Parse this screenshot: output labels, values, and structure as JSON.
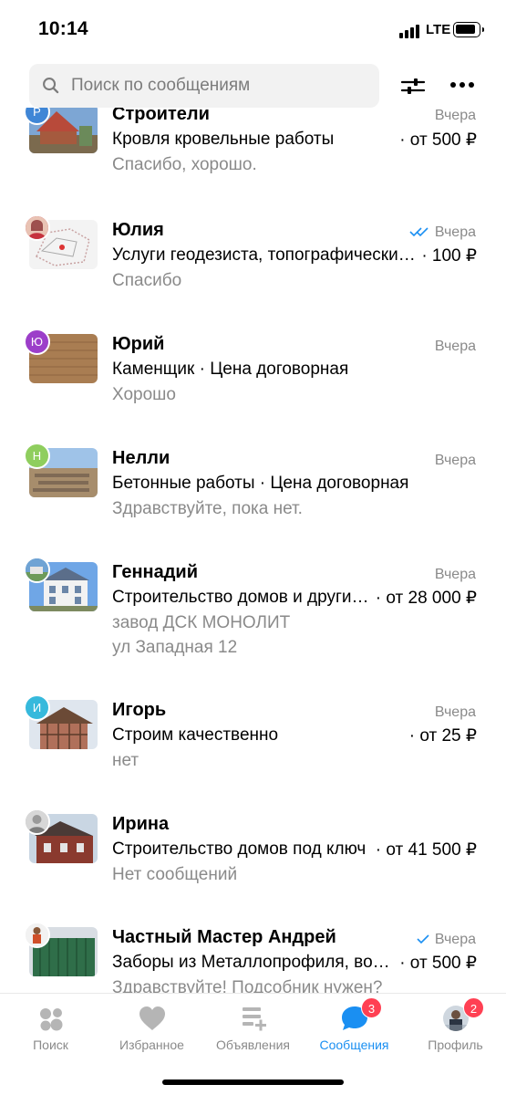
{
  "status_bar": {
    "time": "10:14",
    "network": "LTE"
  },
  "search": {
    "placeholder": "Поиск по сообщениям"
  },
  "icons": {
    "search": "search-icon",
    "filter": "sliders-icon",
    "more": "more-dots-icon",
    "read": "double-check-icon",
    "delivered": "check-icon"
  },
  "colors": {
    "accent": "#1a8ff2",
    "badge": "#ff4053",
    "muted": "#8a8a8a"
  },
  "conversations": [
    {
      "name": "Строители",
      "date": "Вчера",
      "subject": "Кровля кровельные работы",
      "price": "· от 500 ₽",
      "preview": "Спасибо, хорошо.",
      "preview2": "",
      "badge_letter": "Р",
      "badge_color": "#3f86d6",
      "status": ""
    },
    {
      "name": "Юлия",
      "date": "Вчера",
      "subject": "Услуги геодезиста, топографические работы",
      "price": "· 100 ₽",
      "preview": "Спасибо",
      "preview2": "",
      "badge_letter": "",
      "badge_color": "#c6323e",
      "status": "read"
    },
    {
      "name": "Юрий",
      "date": "Вчера",
      "subject": "Каменщик · Цена договорная",
      "price": "",
      "preview": "Хорошо",
      "preview2": "",
      "badge_letter": "Ю",
      "badge_color": "#9c3ec9",
      "status": ""
    },
    {
      "name": "Нелли",
      "date": "Вчера",
      "subject": "Бетонные работы · Цена договорная",
      "price": "",
      "preview": "Здравствуйте, пока нет.",
      "preview2": "",
      "badge_letter": "Н",
      "badge_color": "#8fce5e",
      "status": ""
    },
    {
      "name": "Геннадий",
      "date": "Вчера",
      "subject": "Строительство домов и других объектов",
      "price": "· от 28 000 ₽",
      "preview": "завод ДСК МОНОЛИТ",
      "preview2": "ул Западная 12",
      "badge_letter": "",
      "badge_color": "#4a8fc7",
      "status": ""
    },
    {
      "name": "Игорь",
      "date": "Вчера",
      "subject": "Строим качественно",
      "price": "· от 25 ₽",
      "preview": "нет",
      "preview2": "",
      "badge_letter": "И",
      "badge_color": "#36b9dc",
      "status": ""
    },
    {
      "name": "Ирина",
      "date": "",
      "subject": "Строительство домов под ключ",
      "price": "· от 41 500 ₽",
      "preview": "Нет сообщений",
      "preview2": "",
      "badge_letter": "",
      "badge_color": "#bdbdbd",
      "status": ""
    },
    {
      "name": "Частный Мастер Андрей",
      "date": "Вчера",
      "subject": "Заборы из Металлопрофиля, ворота",
      "price": "· от 500 ₽",
      "preview": "Здравствуйте! Подсобник нужен?",
      "preview2": "",
      "badge_letter": "",
      "badge_color": "#e8e8e8",
      "status": "delivered"
    }
  ],
  "tabs": [
    {
      "label": "Поиск",
      "icon": "search-circles-icon",
      "counter": ""
    },
    {
      "label": "Избранное",
      "icon": "heart-icon",
      "counter": ""
    },
    {
      "label": "Объявления",
      "icon": "listing-add-icon",
      "counter": ""
    },
    {
      "label": "Сообщения",
      "icon": "chat-bubble-icon",
      "counter": "3"
    },
    {
      "label": "Профиль",
      "icon": "profile-avatar-icon",
      "counter": "2"
    }
  ],
  "active_tab": "Сообщения"
}
